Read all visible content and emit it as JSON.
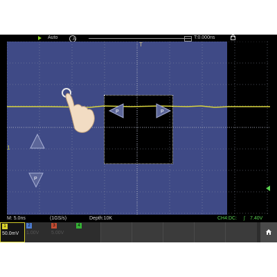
{
  "topbar": {
    "mode": "Auto",
    "trigger_source": "A",
    "time_offset": "T:0.000ns"
  },
  "status": {
    "timebase": "M: 5.0ns",
    "sample_rate": "(1GS/s)",
    "depth": "Depth:10K",
    "trigger": "CH4:DC:",
    "trigger_level": "7.40V"
  },
  "channels": [
    {
      "index": "1",
      "value": "50.0mV",
      "color": "#d9d22d",
      "active": true
    },
    {
      "index": "2",
      "value": "1.00V",
      "color": "#4c7cd1",
      "active": false
    },
    {
      "index": "3",
      "value": "5.00V",
      "color": "#c44d33",
      "active": false
    },
    {
      "index": "4",
      "value": "",
      "color": "#35b235",
      "active": false
    }
  ],
  "markers": {
    "left_marker": "1",
    "trigger_marker": "T"
  },
  "icons": {
    "run": "run-icon",
    "lock": "lock-icon",
    "home": "home-icon",
    "hand": "touch-hand-icon",
    "arrow": "triangle-arrow-icon"
  }
}
